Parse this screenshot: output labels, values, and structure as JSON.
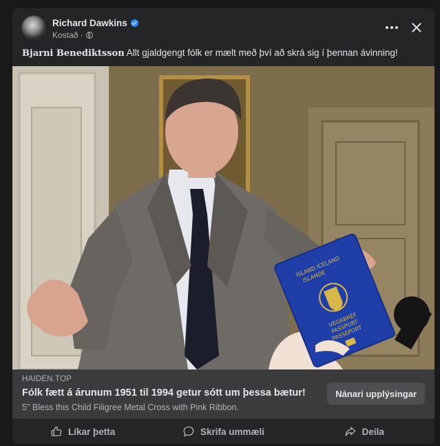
{
  "post": {
    "author": "Richard Dawkins",
    "meta_label": "Kostað ·",
    "caption_name": "Bjarni Benediktsson",
    "caption_text": " Allt gjaldgengt fólk er mælt með því að skrá sig í þennan ávinning!"
  },
  "passport": {
    "line1": "ÍSLAND ICELAND",
    "line2": "ISLANDE",
    "line3": "VEGABRÉF",
    "line4": "PASSPORT",
    "line5": "PASSEPORT"
  },
  "link": {
    "domain": "HAIDEN.TOP",
    "title": "Fólk fætt á árunum 1951 til 1994 getur sótt um þessa bætur!",
    "description": "5\" Bless this Child Filigree Metal Cross with Pink Ribbon.",
    "cta_label": "Nánari upplýsingar"
  },
  "actions": {
    "like": "Líkar þetta",
    "comment": "Skrifa ummæli",
    "share": "Deila"
  },
  "icons": {
    "verified": "verified-badge-icon",
    "globe": "globe-icon",
    "more": "more-options-icon",
    "close": "close-icon",
    "like": "thumbs-up-icon",
    "comment": "comment-bubble-icon",
    "share": "share-arrow-icon"
  },
  "colors": {
    "background": "#18191a",
    "card": "#242526",
    "link_box": "#3a3b3c",
    "verified": "#2d88ff",
    "passport": "#1f3ea8"
  }
}
